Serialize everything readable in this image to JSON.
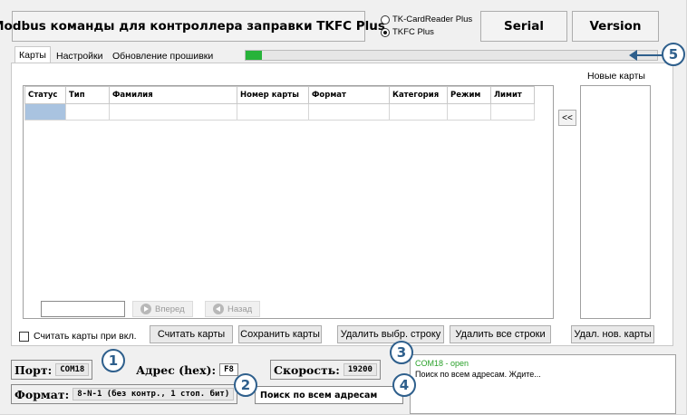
{
  "title": "Modbus команды для контроллера заправки TKFC Plus",
  "mode_options": [
    {
      "label": "TK-CardReader Plus",
      "selected": false
    },
    {
      "label": "TKFC Plus",
      "selected": true
    }
  ],
  "header_buttons": {
    "serial": "Serial",
    "version": "Version"
  },
  "tabs": [
    "Карты",
    "Настройки",
    "Обновление прошивки"
  ],
  "progress": {
    "value_percent": 4,
    "color": "#27b33a"
  },
  "table": {
    "columns": [
      "Статус",
      "Тип",
      "Фамилия",
      "Номер карты",
      "Формат",
      "Категория",
      "Режим",
      "Лимит"
    ],
    "selected_cell_color": "#a9c3e0"
  },
  "new_cards_label": "Новые карты",
  "move_button": "<<",
  "nav": {
    "forward": "Вперед",
    "back": "Назад"
  },
  "checkbox_label": "Считать карты при вкл.",
  "actions": {
    "read": "Считать карты",
    "save": "Сохранить карты",
    "delete_selected": "Удалить выбр. строку",
    "delete_all": "Удалить все строки",
    "delete_new": "Удал. нов. карты"
  },
  "connection": {
    "port_label": "Порт:",
    "port_value": "COM18",
    "address_label": "Адрес (hex):",
    "address_value": "F8",
    "speed_label": "Скорость:",
    "speed_value": "19200",
    "format_label": "Формат:",
    "format_value": "8-N-1 (без контр., 1 стоп. бит)",
    "search_text": "Поиск по всем адресам"
  },
  "log": {
    "line1": "COM18 - open",
    "line1_color": "#2aa12a",
    "line2": "Поиск по всем адресам. Ждите..."
  },
  "callouts": [
    "1",
    "2",
    "3",
    "4",
    "5"
  ],
  "accent_color": "#2e5f8c"
}
